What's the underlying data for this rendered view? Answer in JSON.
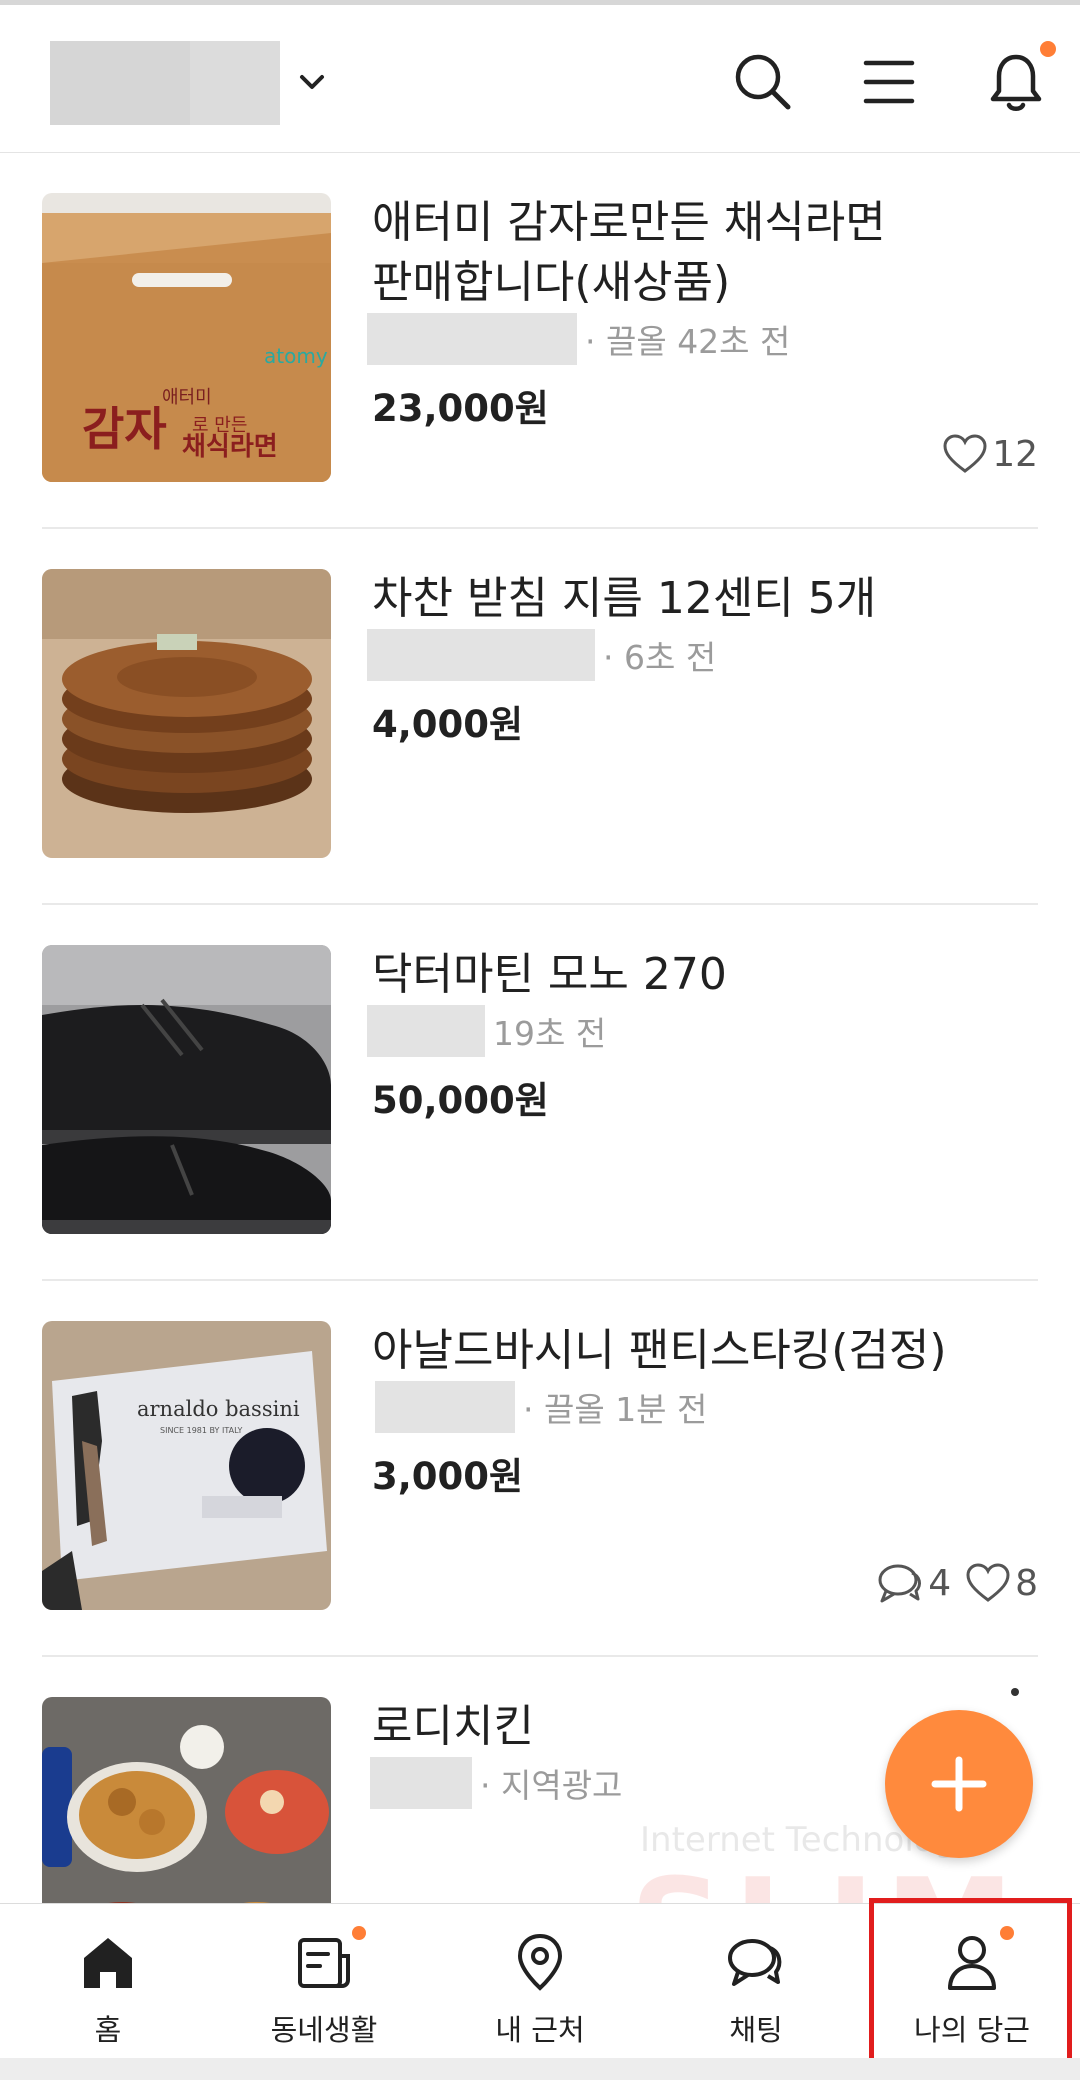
{
  "colors": {
    "accent": "#ff7e36",
    "highlight": "#e11d1d",
    "text": "#212121",
    "muted": "#9b9b9b"
  },
  "header": {
    "icons": [
      "chevron-down-icon",
      "search-icon",
      "menu-icon",
      "bell-icon"
    ]
  },
  "items": [
    {
      "title": "애터미 감자로만든 채식라면\n판매합니다(새상품)",
      "meta": "· 끌올 42초 전",
      "price": "23,000원",
      "comments": "",
      "likes": "12"
    },
    {
      "title": "차찬 받침 지름 12센티 5개",
      "meta": "· 6초 전",
      "price": "4,000원",
      "comments": "",
      "likes": ""
    },
    {
      "title": "닥터마틴 모노 270",
      "meta": "19초 전",
      "price": "50,000원",
      "comments": "",
      "likes": ""
    },
    {
      "title": "아날드바시니 팬티스타킹(검정)",
      "meta": "· 끌올 1분 전",
      "price": "3,000원",
      "comments": "4",
      "likes": "8"
    },
    {
      "title": "로디치킨",
      "meta": "· 지역광고",
      "price": "",
      "comments": "",
      "likes": ""
    }
  ],
  "thumb_labels": {
    "box_brand": "atomy",
    "box_line1": "애터미",
    "box_line2": "감자",
    "box_line3": "로 만든",
    "box_line4": "채식라면",
    "stocking_brand": "arnaldo bassini",
    "stocking_sub": "SINCE 1981 BY ITALY"
  },
  "watermark": {
    "sub": "Internet Technology",
    "main": "SLIM"
  },
  "bottom_nav": [
    {
      "label": "홈",
      "icon": "home-icon"
    },
    {
      "label": "동네생활",
      "icon": "neighborhood-icon"
    },
    {
      "label": "내 근처",
      "icon": "location-pin-icon"
    },
    {
      "label": "채팅",
      "icon": "chat-icon"
    },
    {
      "label": "나의 당근",
      "icon": "profile-icon"
    }
  ]
}
